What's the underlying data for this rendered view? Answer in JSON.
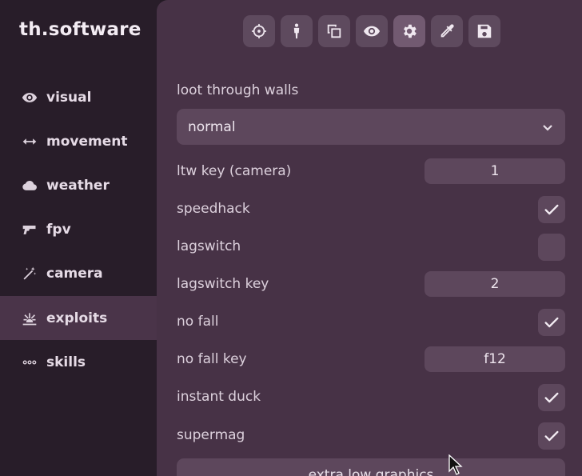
{
  "app": {
    "brand": "th.software"
  },
  "sidebar": {
    "items": [
      {
        "label": "visual",
        "icon": "eye-icon",
        "active": false
      },
      {
        "label": "movement",
        "icon": "arrows-horizontal-icon",
        "active": false
      },
      {
        "label": "weather",
        "icon": "cloud-icon",
        "active": false
      },
      {
        "label": "fpv",
        "icon": "gun-icon",
        "active": false
      },
      {
        "label": "camera",
        "icon": "magic-wand-icon",
        "active": false
      },
      {
        "label": "exploits",
        "icon": "explosion-icon",
        "active": true
      },
      {
        "label": "skills",
        "icon": "dots-icon",
        "active": false
      }
    ]
  },
  "toolbar": {
    "buttons": [
      {
        "icon": "crosshair-icon",
        "active": false
      },
      {
        "icon": "person-icon",
        "active": false
      },
      {
        "icon": "copy-icon",
        "active": false
      },
      {
        "icon": "eye-icon",
        "active": false
      },
      {
        "icon": "gear-icon",
        "active": true
      },
      {
        "icon": "eyedropper-icon",
        "active": false
      },
      {
        "icon": "save-icon",
        "active": false
      }
    ]
  },
  "settings": {
    "loot_through_walls": {
      "label": "loot through walls",
      "value": "normal"
    },
    "ltw_key": {
      "label": "ltw key (camera)",
      "value": "1"
    },
    "speedhack": {
      "label": "speedhack",
      "checked": true
    },
    "lagswitch": {
      "label": "lagswitch",
      "checked": false
    },
    "lagswitch_key": {
      "label": "lagswitch key",
      "value": "2"
    },
    "no_fall": {
      "label": "no fall",
      "checked": true
    },
    "no_fall_key": {
      "label": "no fall key",
      "value": "f12"
    },
    "instant_duck": {
      "label": "instant duck",
      "checked": true
    },
    "supermag": {
      "label": "supermag",
      "checked": true
    },
    "extra_low_graphics": {
      "label": "extra low graphics"
    }
  },
  "colors": {
    "background": "#231a24",
    "sidebar": "#281d29",
    "panel": "#473246",
    "control": "#5d475c",
    "active_nav": "#4a3449"
  }
}
